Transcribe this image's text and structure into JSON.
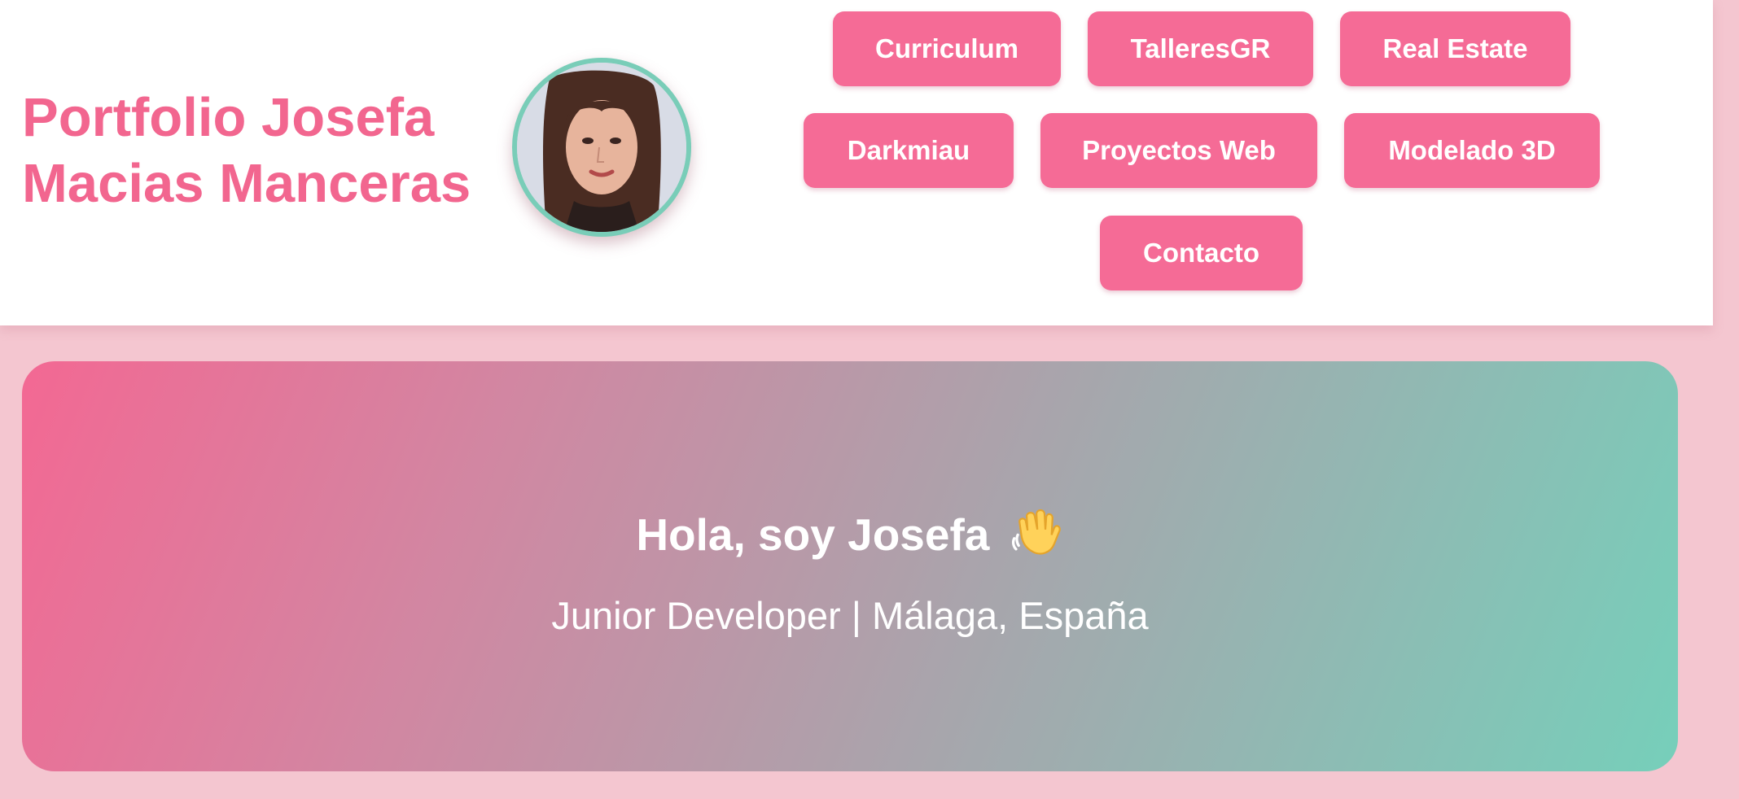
{
  "header": {
    "title": "Portfolio Josefa Macias Manceras",
    "avatar_alt": "Foto de perfil",
    "accent_color": "#f2668f",
    "avatar_border_color": "#79cdb8"
  },
  "nav": {
    "items": [
      {
        "label": "Curriculum"
      },
      {
        "label": "TalleresGR"
      },
      {
        "label": "Real Estate"
      },
      {
        "label": "Darkmiau"
      },
      {
        "label": "Proyectos Web"
      },
      {
        "label": "Modelado 3D"
      },
      {
        "label": "Contacto"
      }
    ],
    "button_color": "#f56b96"
  },
  "hero": {
    "greeting": "Hola, soy Josefa",
    "emoji_icon": "waving-hand-icon",
    "subtitle": "Junior Developer | Málaga, España",
    "gradient_start": "#f36893",
    "gradient_end": "#76cfba"
  },
  "page": {
    "background_color": "#f4c6d0"
  }
}
